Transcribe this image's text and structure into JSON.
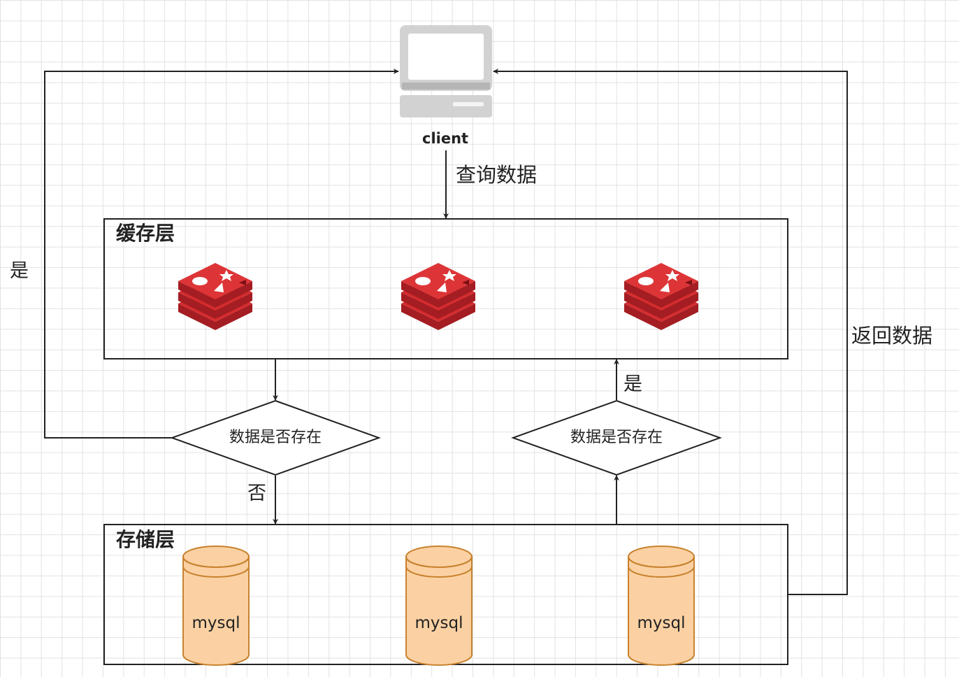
{
  "client": {
    "label": "client"
  },
  "edges": {
    "query_label": "查询数据",
    "return_label": "返回数据",
    "yes_left": "是",
    "yes_right": "是",
    "no_label": "否"
  },
  "cache_layer": {
    "title": "缓存层",
    "nodes": 3
  },
  "storage_layer": {
    "title": "存储层",
    "databases": [
      "mysql",
      "mysql",
      "mysql"
    ]
  },
  "decisions": [
    "数据是否存在",
    "数据是否存在"
  ],
  "colors": {
    "line": "#222222",
    "redis_red": "#c8242a",
    "db_fill": "#fbd1a3",
    "db_stroke": "#c8822e",
    "monitor_gray": "#cfcfcf"
  }
}
